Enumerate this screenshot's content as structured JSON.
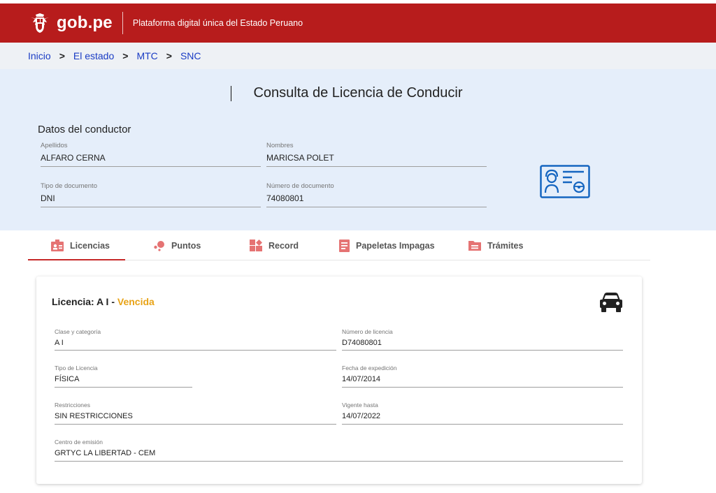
{
  "header": {
    "logo_text": "gob.pe",
    "subtitle": "Plataforma digital única del Estado Peruano",
    "brand_color": "#b71c1c"
  },
  "breadcrumb": {
    "items": [
      "Inicio",
      "El estado",
      "MTC",
      "SNC"
    ],
    "separator": ">"
  },
  "page": {
    "title": "Consulta de Licencia de Conducir"
  },
  "conductor": {
    "section_title": "Datos del conductor",
    "apellidos_label": "Apellidos",
    "apellidos_value": "ALFARO CERNA",
    "nombres_label": "Nombres",
    "nombres_value": "MARICSA POLET",
    "tipo_doc_label": "Tipo de documento",
    "tipo_doc_value": "DNI",
    "num_doc_label": "Número de documento",
    "num_doc_value": "74080801",
    "icon": "id-card-icon"
  },
  "tabs": [
    {
      "label": "Licencias",
      "icon": "license-icon",
      "active": true
    },
    {
      "label": "Puntos",
      "icon": "points-icon",
      "active": false
    },
    {
      "label": "Record",
      "icon": "record-icon",
      "active": false
    },
    {
      "label": "Papeletas Impagas",
      "icon": "ticket-icon",
      "active": false
    },
    {
      "label": "Trámites",
      "icon": "folder-icon",
      "active": false
    }
  ],
  "licencia": {
    "title_prefix": "Licencia: A I - ",
    "status": "Vencida",
    "status_color": "#e8a317",
    "icon": "car-icon",
    "clase_label": "Clase y categoría",
    "clase_value": "A I",
    "numero_label": "Número de licencia",
    "numero_value": "D74080801",
    "tipo_label": "Tipo de Licencia",
    "tipo_value": "FÍSICA",
    "fecha_label": "Fecha de expedición",
    "fecha_value": "14/07/2014",
    "restricciones_label": "Restricciones",
    "restricciones_value": "SIN RESTRICCIONES",
    "vigente_label": "Vigente hasta",
    "vigente_value": "14/07/2022",
    "centro_label": "Centro de emisión",
    "centro_value": "GRTYC LA LIBERTAD - CEM"
  }
}
